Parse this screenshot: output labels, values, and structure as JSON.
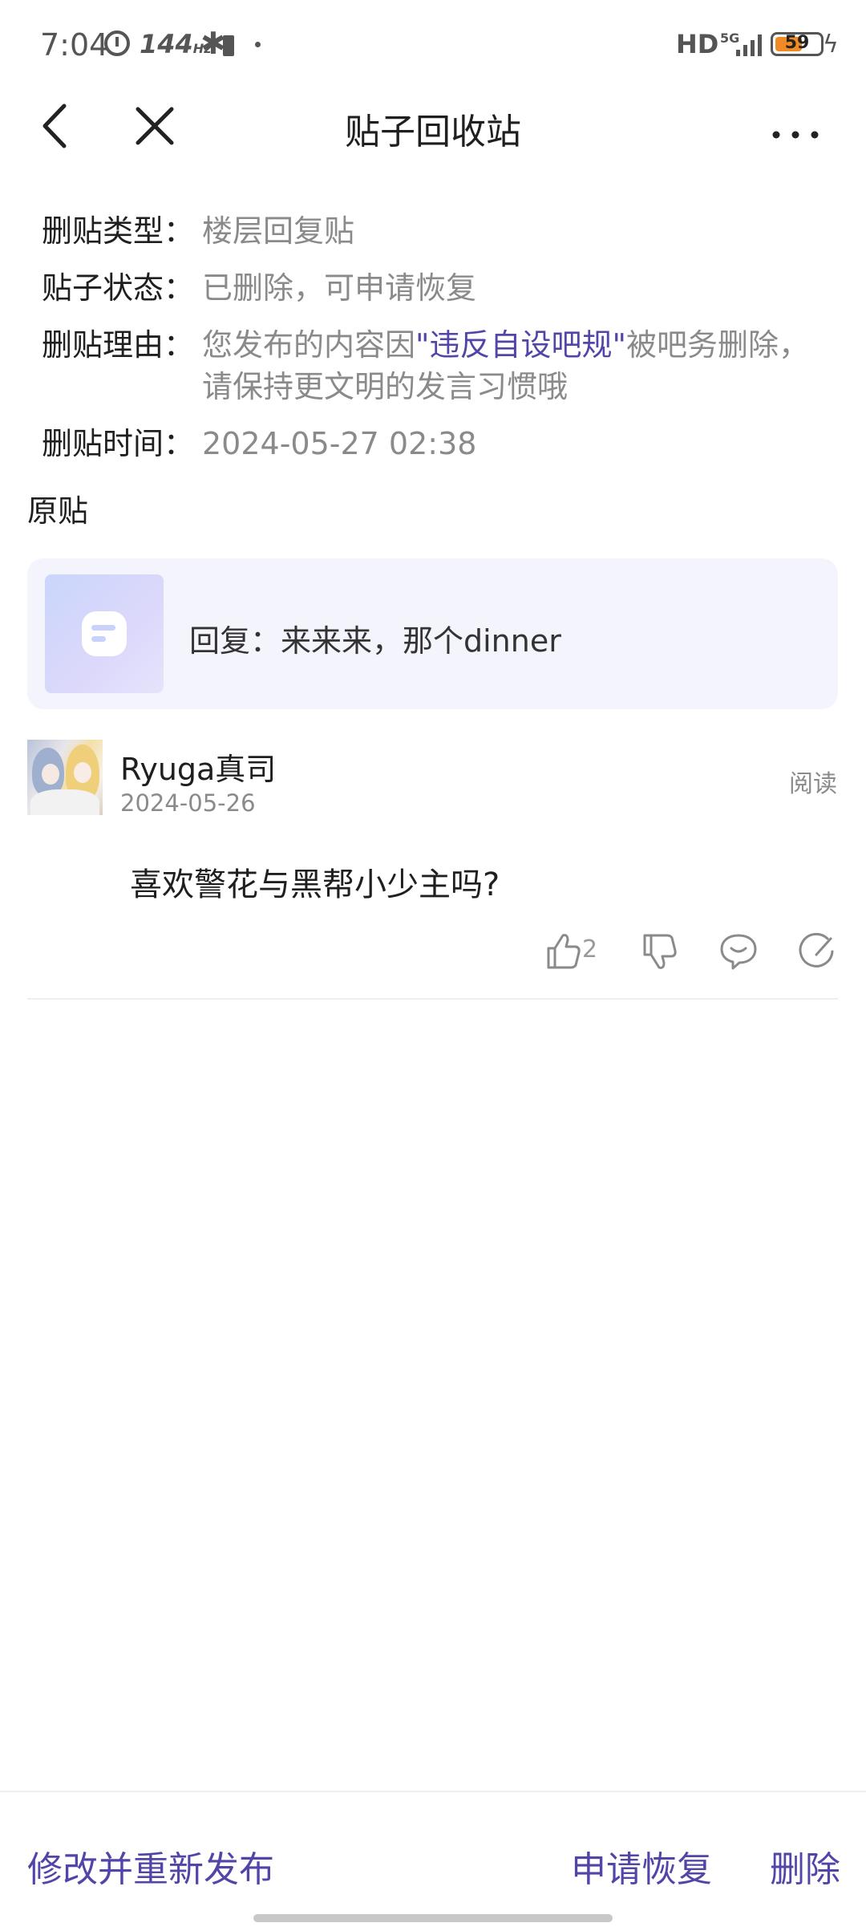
{
  "status_bar": {
    "time": "7:04",
    "refresh_rate": "144",
    "refresh_unit": "Hz",
    "network_hd": "HD",
    "network_5g": "5G",
    "battery_level": "59",
    "battery_color": "#f08a24"
  },
  "nav": {
    "title": "贴子回收站",
    "back_icon": "chevron-left-icon",
    "close_icon": "close-icon",
    "more_icon": "more-horizontal-icon"
  },
  "info": {
    "type_label": "删贴类型：",
    "type_value": "楼层回复贴",
    "status_label": "贴子状态：",
    "status_value": "已删除，可申请恢复",
    "reason_label": "删贴理由：",
    "reason_prefix": "您发布的内容因",
    "reason_link": "\"违反自设吧规\"",
    "reason_suffix": "被吧务删除，请保持更文明的发言习惯哦",
    "time_label": "删贴时间：",
    "time_value": "2024-05-27 02:38"
  },
  "original": {
    "section_title": "原贴",
    "card_text": "回复：来来来，那个dinner"
  },
  "reply": {
    "username": "Ryuga真司",
    "date": "2024-05-26",
    "read_label": "阅读",
    "body": "喜欢警花与黑帮小少主吗?",
    "like_count": "2"
  },
  "bottom": {
    "republish_label": "修改并重新发布",
    "restore_label": "申请恢复",
    "delete_label": "删除"
  },
  "colors": {
    "accent": "#5146a8",
    "muted_text": "#8a8a8a",
    "card_bg": "#f4f4fd"
  }
}
